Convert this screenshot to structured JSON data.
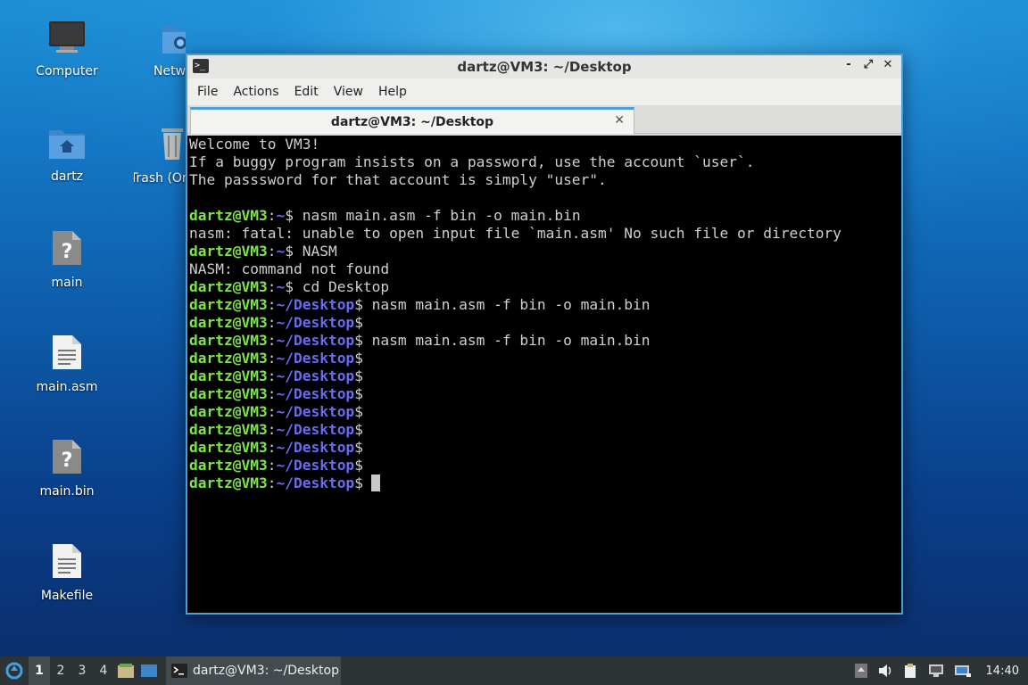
{
  "desktop": {
    "icons": [
      {
        "label": "Computer"
      },
      {
        "label": "Netw"
      },
      {
        "label": "dartz"
      },
      {
        "label": "Trash (Or"
      },
      {
        "label": "main"
      },
      {
        "label": "main.asm"
      },
      {
        "label": "main.bin"
      },
      {
        "label": "Makefile"
      }
    ]
  },
  "window": {
    "title": "dartz@VM3: ~/Desktop",
    "controls": {
      "minimize": "-",
      "maximize": "⤢",
      "close": "✕"
    },
    "menu": [
      "File",
      "Actions",
      "Edit",
      "View",
      "Help"
    ],
    "tab": {
      "title": "dartz@VM3: ~/Desktop",
      "close": "✕"
    }
  },
  "terminal": {
    "lines": [
      {
        "type": "out",
        "text": "Welcome to VM3!"
      },
      {
        "type": "out",
        "text": "If a buggy program insists on a password, use the account `user`."
      },
      {
        "type": "out",
        "text": "The passsword for that account is simply \"user\"."
      },
      {
        "type": "out",
        "text": ""
      },
      {
        "type": "prompt",
        "user": "dartz@VM3",
        "path": "~",
        "cmd": " nasm main.asm -f bin -o main.bin"
      },
      {
        "type": "out",
        "text": "nasm: fatal: unable to open input file `main.asm' No such file or directory"
      },
      {
        "type": "prompt",
        "user": "dartz@VM3",
        "path": "~",
        "cmd": " NASM"
      },
      {
        "type": "out",
        "text": "NASM: command not found"
      },
      {
        "type": "prompt",
        "user": "dartz@VM3",
        "path": "~",
        "cmd": " cd Desktop"
      },
      {
        "type": "prompt",
        "user": "dartz@VM3",
        "path": "~/Desktop",
        "cmd": " nasm main.asm -f bin -o main.bin"
      },
      {
        "type": "prompt",
        "user": "dartz@VM3",
        "path": "~/Desktop",
        "cmd": ""
      },
      {
        "type": "prompt",
        "user": "dartz@VM3",
        "path": "~/Desktop",
        "cmd": " nasm main.asm -f bin -o main.bin"
      },
      {
        "type": "prompt",
        "user": "dartz@VM3",
        "path": "~/Desktop",
        "cmd": ""
      },
      {
        "type": "prompt",
        "user": "dartz@VM3",
        "path": "~/Desktop",
        "cmd": ""
      },
      {
        "type": "prompt",
        "user": "dartz@VM3",
        "path": "~/Desktop",
        "cmd": ""
      },
      {
        "type": "prompt",
        "user": "dartz@VM3",
        "path": "~/Desktop",
        "cmd": ""
      },
      {
        "type": "prompt",
        "user": "dartz@VM3",
        "path": "~/Desktop",
        "cmd": ""
      },
      {
        "type": "prompt",
        "user": "dartz@VM3",
        "path": "~/Desktop",
        "cmd": ""
      },
      {
        "type": "prompt",
        "user": "dartz@VM3",
        "path": "~/Desktop",
        "cmd": ""
      },
      {
        "type": "prompt",
        "user": "dartz@VM3",
        "path": "~/Desktop",
        "cmd": "",
        "cursor": true
      }
    ]
  },
  "taskbar": {
    "workspaces": [
      "1",
      "2",
      "3",
      "4"
    ],
    "active_workspace": "1",
    "task_label": "dartz@VM3: ~/Desktop",
    "clock": "14:40"
  },
  "colors": {
    "prompt_user": "#7ee34d",
    "prompt_path": "#6a6cf2",
    "accent": "#4a9fd9"
  }
}
